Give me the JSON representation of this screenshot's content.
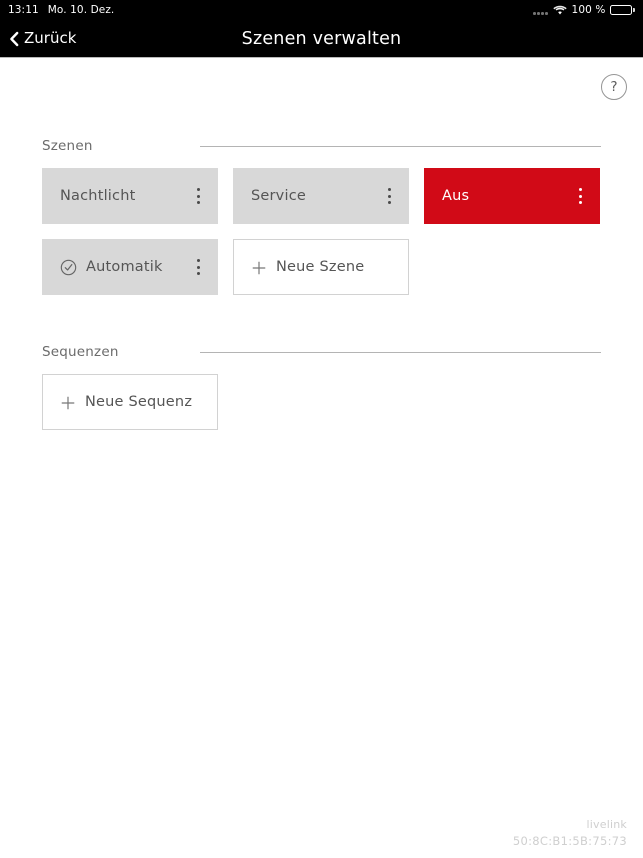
{
  "statusbar": {
    "time": "13:11",
    "date": "Mo. 10. Dez.",
    "signal_icon": "signal-dots-icon",
    "wifi_icon": "wifi-icon",
    "battery_percent": "100 %",
    "battery_icon": "battery-full-icon"
  },
  "navbar": {
    "back_label": "Zurück",
    "back_icon": "chevron-left-icon",
    "title": "Szenen verwalten"
  },
  "toolbar": {
    "help_label": "?",
    "help_icon": "question-mark-icon"
  },
  "sections": [
    {
      "id": "szenen",
      "title": "Szenen",
      "tiles": [
        {
          "label": "Nachtlicht",
          "style": "filled",
          "icon": null,
          "menu_icon": "kebab-menu-icon",
          "has_menu": true
        },
        {
          "label": "Service",
          "style": "filled",
          "icon": null,
          "menu_icon": "kebab-menu-icon",
          "has_menu": true
        },
        {
          "label": "Aus",
          "style": "active",
          "icon": null,
          "menu_icon": "kebab-menu-icon",
          "has_menu": true
        },
        {
          "label": "Automatik",
          "style": "filled",
          "icon": "check-circle-icon",
          "menu_icon": "kebab-menu-icon",
          "has_menu": true
        },
        {
          "label": "Neue Szene",
          "style": "outline",
          "icon": "plus-icon",
          "menu_icon": null,
          "has_menu": false
        }
      ]
    },
    {
      "id": "sequenzen",
      "title": "Sequenzen",
      "tiles": [
        {
          "label": "Neue Sequenz",
          "style": "outline",
          "icon": "plus-icon",
          "menu_icon": null,
          "has_menu": false
        }
      ]
    }
  ],
  "footer": {
    "brand": "livelink",
    "mac_address": "50:8C:B1:5B:75:73"
  },
  "colors": {
    "accent_red": "#D10A17",
    "tile_gray": "#D8D8D8",
    "nav_black": "#000000",
    "text_gray": "#555555",
    "footer_gray": "#CFCFCF"
  }
}
